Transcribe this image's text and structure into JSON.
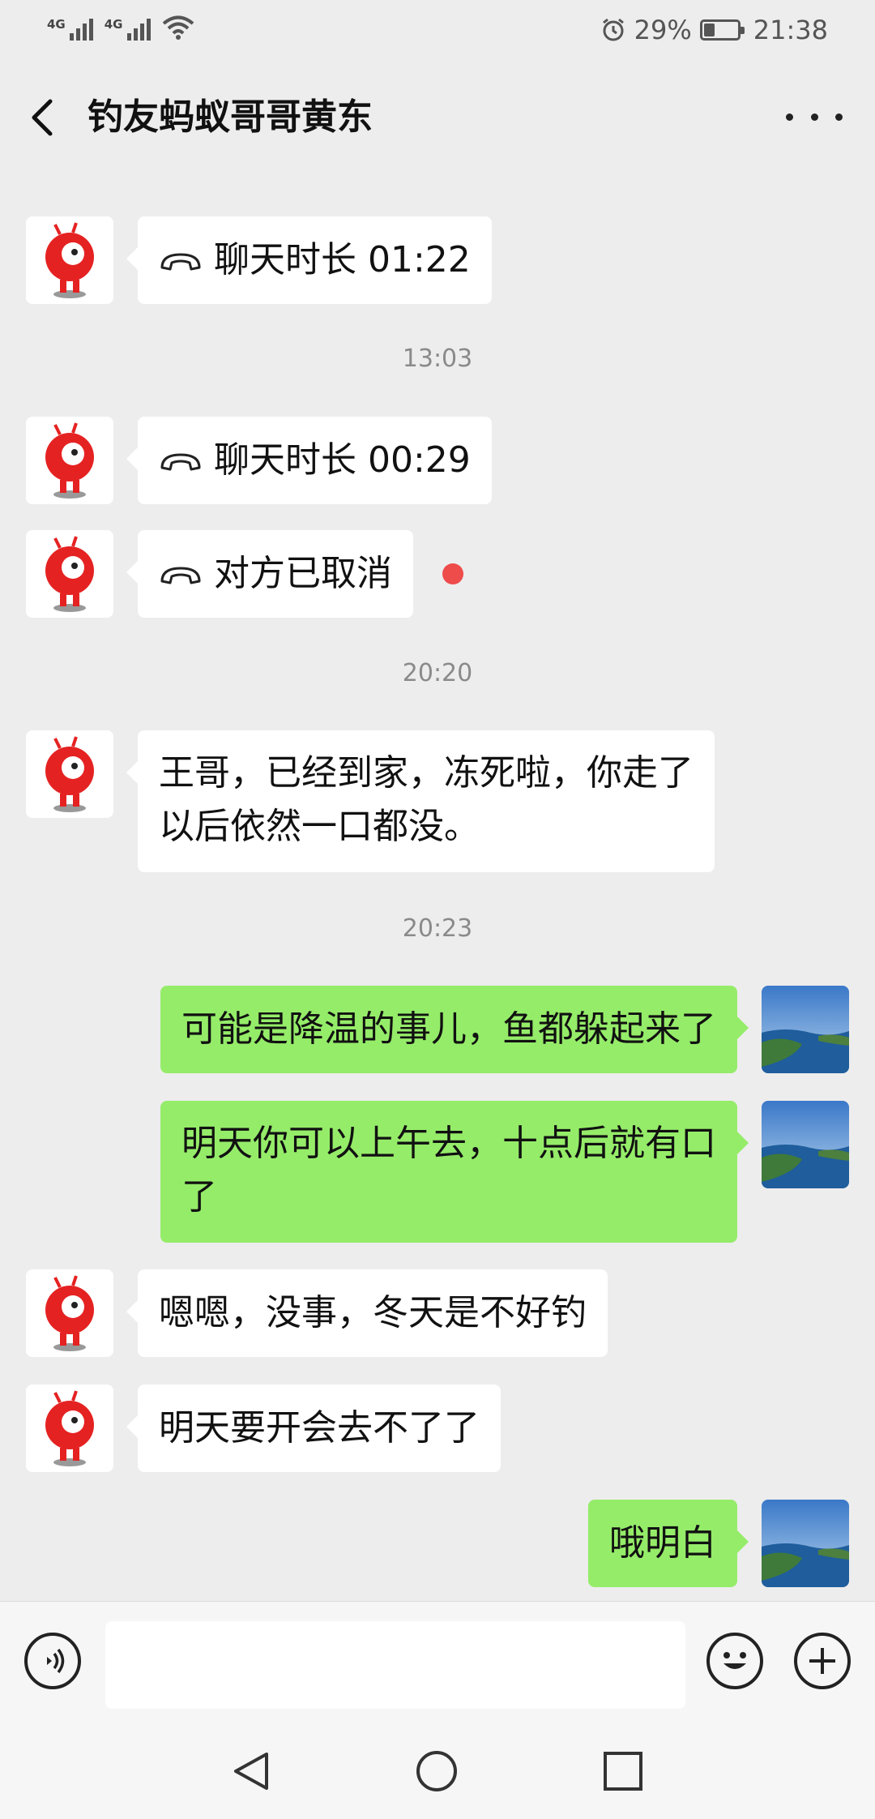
{
  "status_bar": {
    "signal1_label": "4G",
    "signal2_label": "4G",
    "battery_percent": "29%",
    "battery_level": 0.29,
    "time": "21:38"
  },
  "header": {
    "title": "钓友蚂蚁哥哥黄东"
  },
  "messages": {
    "m1": {
      "text": "聊天时长 01:22"
    },
    "ts1": "13:03",
    "m2": {
      "text": "聊天时长 00:29"
    },
    "m3": {
      "text": "对方已取消"
    },
    "ts2": "20:20",
    "m4": {
      "line1": "王哥，已经到家，冻死啦，你走了",
      "line2": "以后依然一口都没。"
    },
    "ts3": "20:23",
    "m5": {
      "text": "可能是降温的事儿，鱼都躲起来了"
    },
    "m6": {
      "line1": "明天你可以上午去，十点后就有口",
      "line2": "了"
    },
    "m7": {
      "text": "嗯嗯，没事，冬天是不好钓"
    },
    "m8": {
      "text": "明天要开会去不了了"
    },
    "m9": {
      "text": "哦明白"
    }
  },
  "colors": {
    "outgoing_bubble": "#95ec69",
    "incoming_bubble": "#ffffff",
    "background": "#ededed",
    "unread_dot": "#ee4b4b"
  },
  "icons": [
    "back-arrow-icon",
    "more-icon",
    "phone-icon",
    "voice-icon",
    "emoji-icon",
    "plus-icon",
    "nav-back-icon",
    "nav-home-icon",
    "nav-recents-icon"
  ]
}
